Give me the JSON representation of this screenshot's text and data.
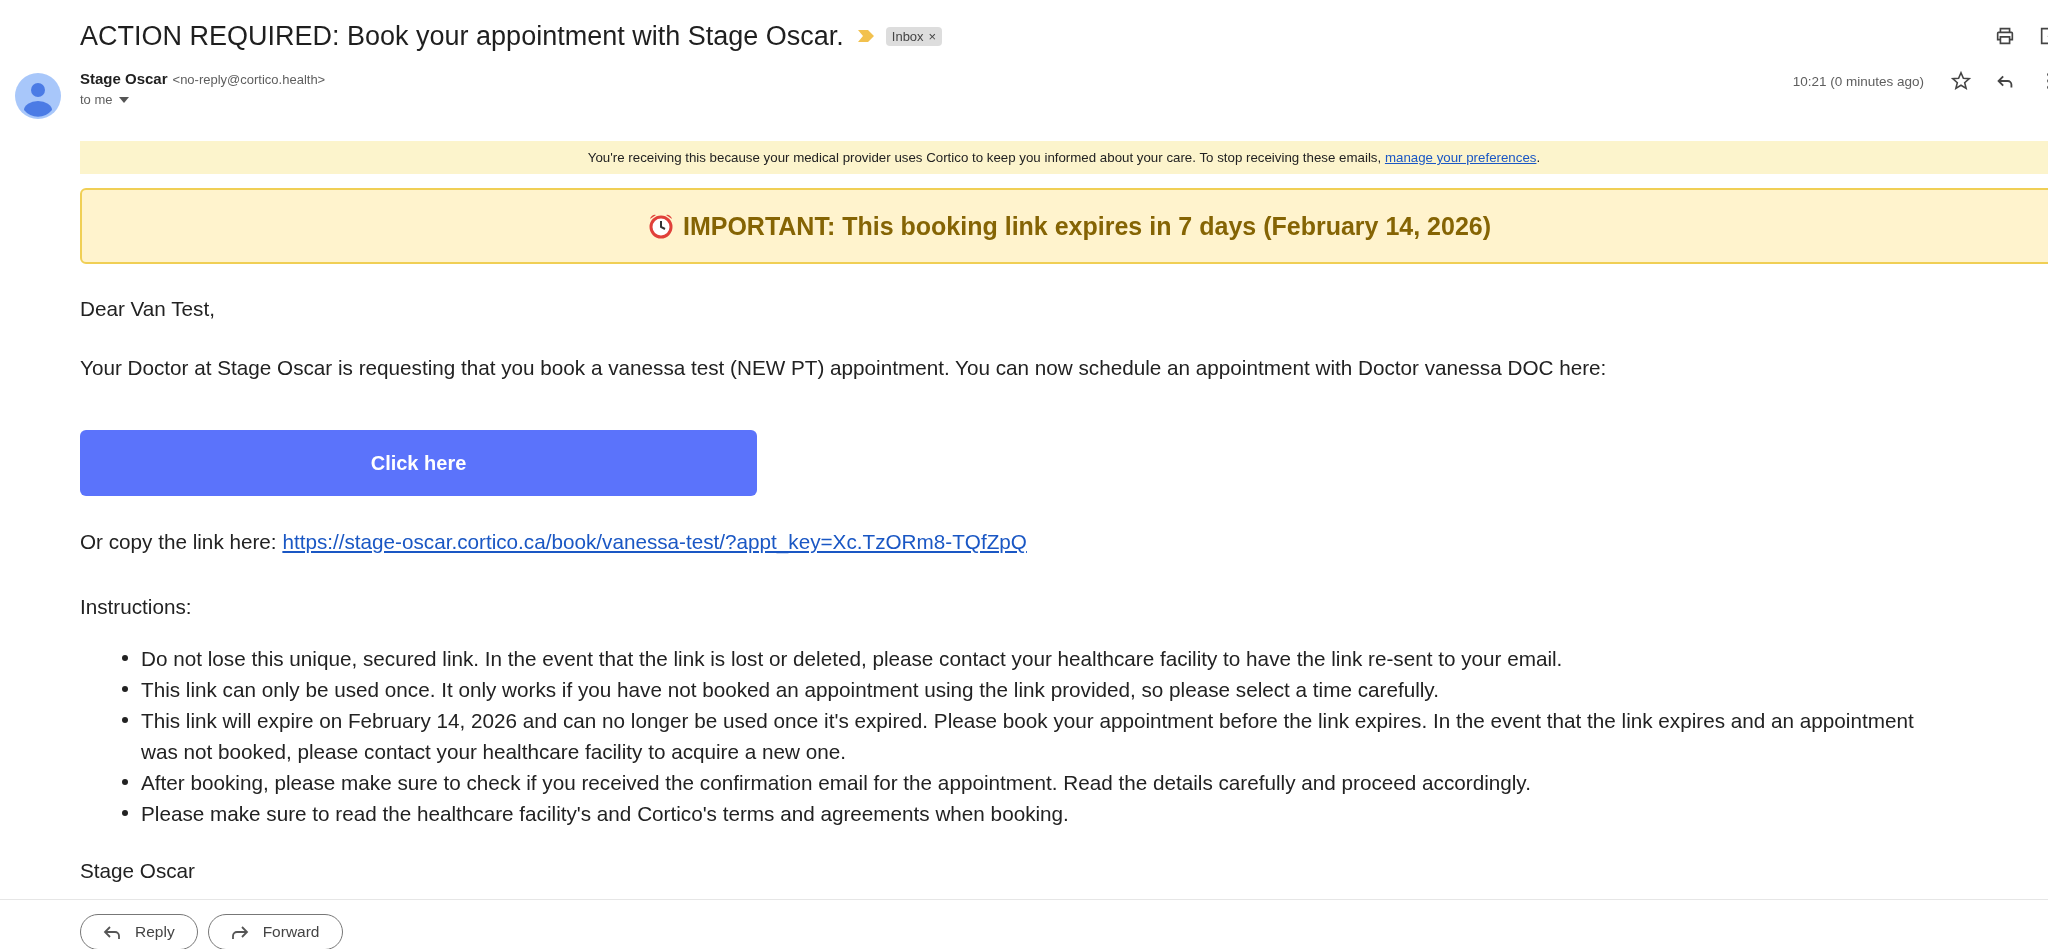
{
  "subject": "ACTION REQUIRED: Book your appointment with Stage Oscar.",
  "labels": [
    {
      "text": "Inbox",
      "remove": "×"
    }
  ],
  "sender": {
    "name": "Stage Oscar",
    "address": "<no-reply@cortico.health>",
    "recipient": "to me",
    "time": "10:21 (0 minutes ago)"
  },
  "notice": {
    "text": "You're receiving this because your medical provider uses Cortico to keep you informed about your care. To stop receiving these emails, ",
    "link": "manage your preferences",
    "end": "."
  },
  "alert": "IMPORTANT: This booking link expires in 7 days (February 14, 2026)",
  "greeting": "Dear Van Test,",
  "intro": "Your Doctor at Stage Oscar is requesting that you book a vanessa test (NEW PT) appointment. You can now schedule an appointment with Doctor vanessa DOC here:",
  "cta": "Click here",
  "copy": {
    "text": "Or copy the link here:",
    "link": "https://stage-oscar.cortico.ca/book/vanessa-test/?appt_key=Xc.TzORm8-TQfZpQ"
  },
  "instructions_heading": "Instructions:",
  "instructions": [
    "Do not lose this unique, secured link. In the event that the link is lost or deleted, please contact your healthcare facility to have the link re-sent to your email.",
    "This link can only be used once. It only works if you have not booked an appointment using the link provided, so please select a time carefully.",
    "This link will expire on February 14, 2026 and can no longer be used once it's expired. Please book your appointment before the link expires. In the event that the link expires and an appointment was not booked, please contact your healthcare facility to acquire a new one.",
    "After booking, please make sure to check if you received the confirmation email for the appointment. Read the details carefully and proceed accordingly.",
    "Please make sure to read the healthcare facility's and Cortico's terms and agreements when booking."
  ],
  "signature": "Stage Oscar",
  "actions": [
    {
      "label": "Reply",
      "kind": "reply"
    },
    {
      "label": "Forward",
      "kind": "forward"
    }
  ]
}
